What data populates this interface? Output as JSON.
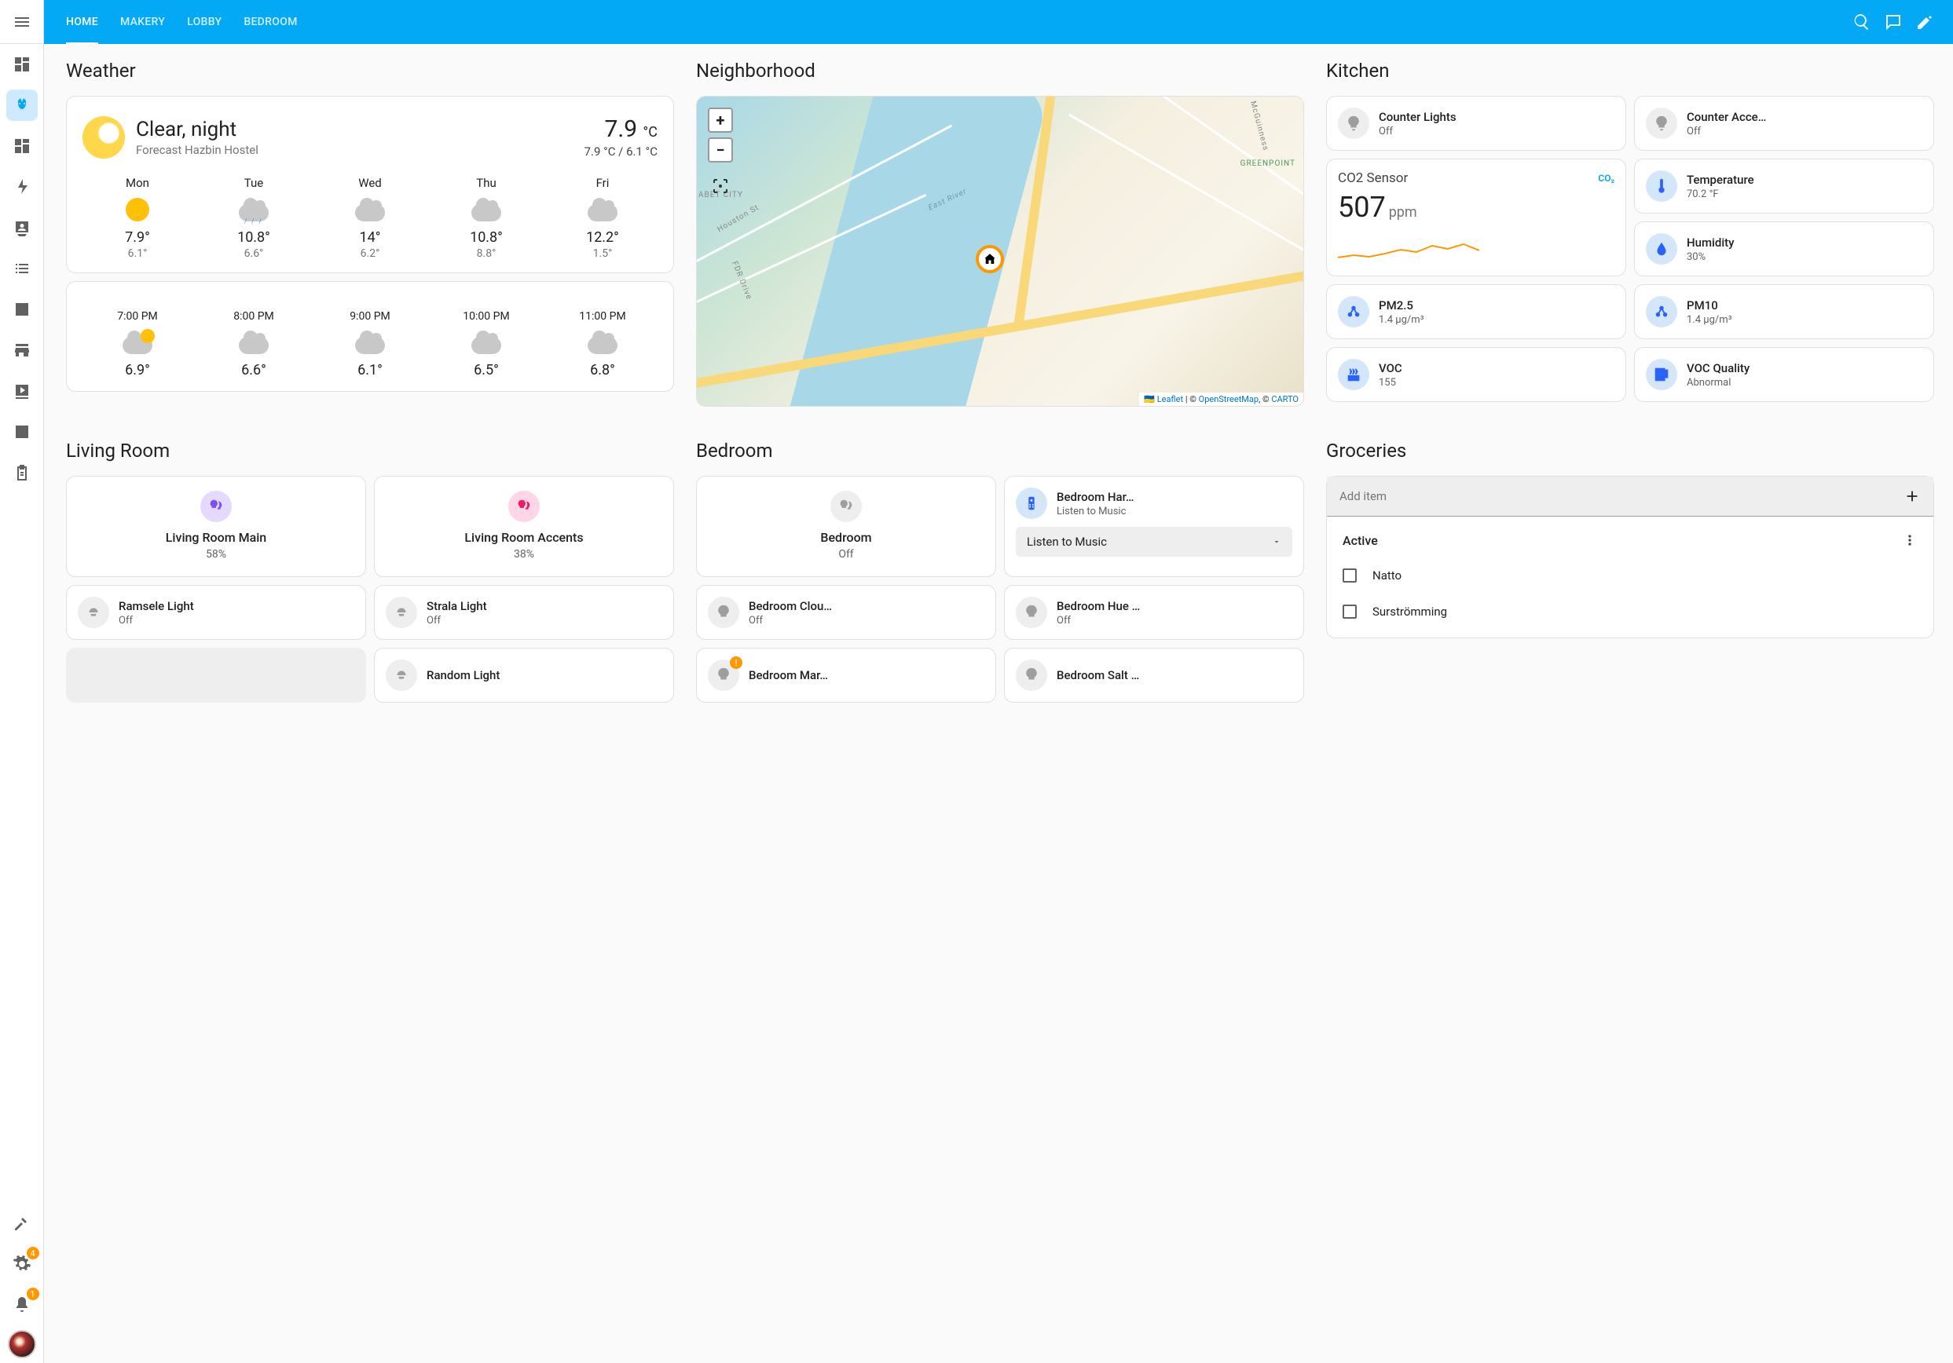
{
  "header": {
    "tabs": [
      "HOME",
      "MAKERY",
      "LOBBY",
      "BEDROOM"
    ],
    "active_tab": 0
  },
  "sidebar": {
    "hammer_badge": null,
    "settings_badge": "4",
    "notifications_badge": "1"
  },
  "weather": {
    "section_title": "Weather",
    "condition": "Clear, night",
    "subtitle": "Forecast Hazbin Hostel",
    "temp": "7.9",
    "temp_unit": "°C",
    "high_low": "7.9 °C / 6.1 °C",
    "daily": [
      {
        "day": "Mon",
        "icon": "sunny",
        "hi": "7.9°",
        "lo": "6.1°"
      },
      {
        "day": "Tue",
        "icon": "rainy",
        "hi": "10.8°",
        "lo": "6.6°"
      },
      {
        "day": "Wed",
        "icon": "cloudy",
        "hi": "14°",
        "lo": "6.2°"
      },
      {
        "day": "Thu",
        "icon": "cloudy",
        "hi": "10.8°",
        "lo": "8.8°"
      },
      {
        "day": "Fri",
        "icon": "cloudy",
        "hi": "12.2°",
        "lo": "1.5°"
      }
    ],
    "hourly": [
      {
        "time": "7:00 PM",
        "icon": "partly",
        "temp": "6.9°"
      },
      {
        "time": "8:00 PM",
        "icon": "cloudy",
        "temp": "6.6°"
      },
      {
        "time": "9:00 PM",
        "icon": "cloudy",
        "temp": "6.1°"
      },
      {
        "time": "10:00 PM",
        "icon": "cloudy",
        "temp": "6.5°"
      },
      {
        "time": "11:00 PM",
        "icon": "cloudy",
        "temp": "6.8°"
      }
    ]
  },
  "neighborhood": {
    "section_title": "Neighborhood",
    "labels": {
      "abet_city": "ABET CITY",
      "greenpoint": "GREENPOINT",
      "east_river": "East River",
      "fdr": "FDR Drive",
      "houston": "Houston St",
      "mcguinness": "McGuinness"
    },
    "attribution": {
      "leaflet": "Leaflet",
      "osm": "OpenStreetMap",
      "carto": "CARTO"
    }
  },
  "kitchen": {
    "section_title": "Kitchen",
    "counter_lights": {
      "title": "Counter Lights",
      "state": "Off"
    },
    "counter_accents": {
      "title": "Counter Acce…",
      "state": "Off"
    },
    "co2": {
      "title": "CO2 Sensor",
      "badge": "CO₂",
      "value": "507",
      "unit": "ppm"
    },
    "temperature": {
      "title": "Temperature",
      "value": "70.2 °F"
    },
    "humidity": {
      "title": "Humidity",
      "value": "30%"
    },
    "pm25": {
      "title": "PM2.5",
      "value": "1.4 µg/m³"
    },
    "pm10": {
      "title": "PM10",
      "value": "1.4 µg/m³"
    },
    "voc": {
      "title": "VOC",
      "value": "155"
    },
    "voc_quality": {
      "title": "VOC Quality",
      "value": "Abnormal"
    }
  },
  "living_room": {
    "section_title": "Living Room",
    "main": {
      "title": "Living Room Main",
      "state": "58%"
    },
    "accents": {
      "title": "Living Room Accents",
      "state": "38%"
    },
    "ramsele": {
      "title": "Ramsele Light",
      "state": "Off"
    },
    "strala": {
      "title": "Strala Light",
      "state": "Off"
    },
    "random": {
      "title": "Random Light"
    }
  },
  "bedroom": {
    "section_title": "Bedroom",
    "main": {
      "title": "Bedroom",
      "state": "Off"
    },
    "harmony": {
      "title": "Bedroom Har…",
      "state": "Listen to Music"
    },
    "dropdown_label": "Listen to Music",
    "cloud": {
      "title": "Bedroom Clou…",
      "state": "Off"
    },
    "hue": {
      "title": "Bedroom Hue …",
      "state": "Off"
    },
    "marquee": {
      "title": "Bedroom Mar…"
    },
    "salt": {
      "title": "Bedroom Salt …"
    }
  },
  "groceries": {
    "section_title": "Groceries",
    "input_placeholder": "Add item",
    "list_header": "Active",
    "items": [
      "Natto",
      "Surströmming"
    ]
  }
}
